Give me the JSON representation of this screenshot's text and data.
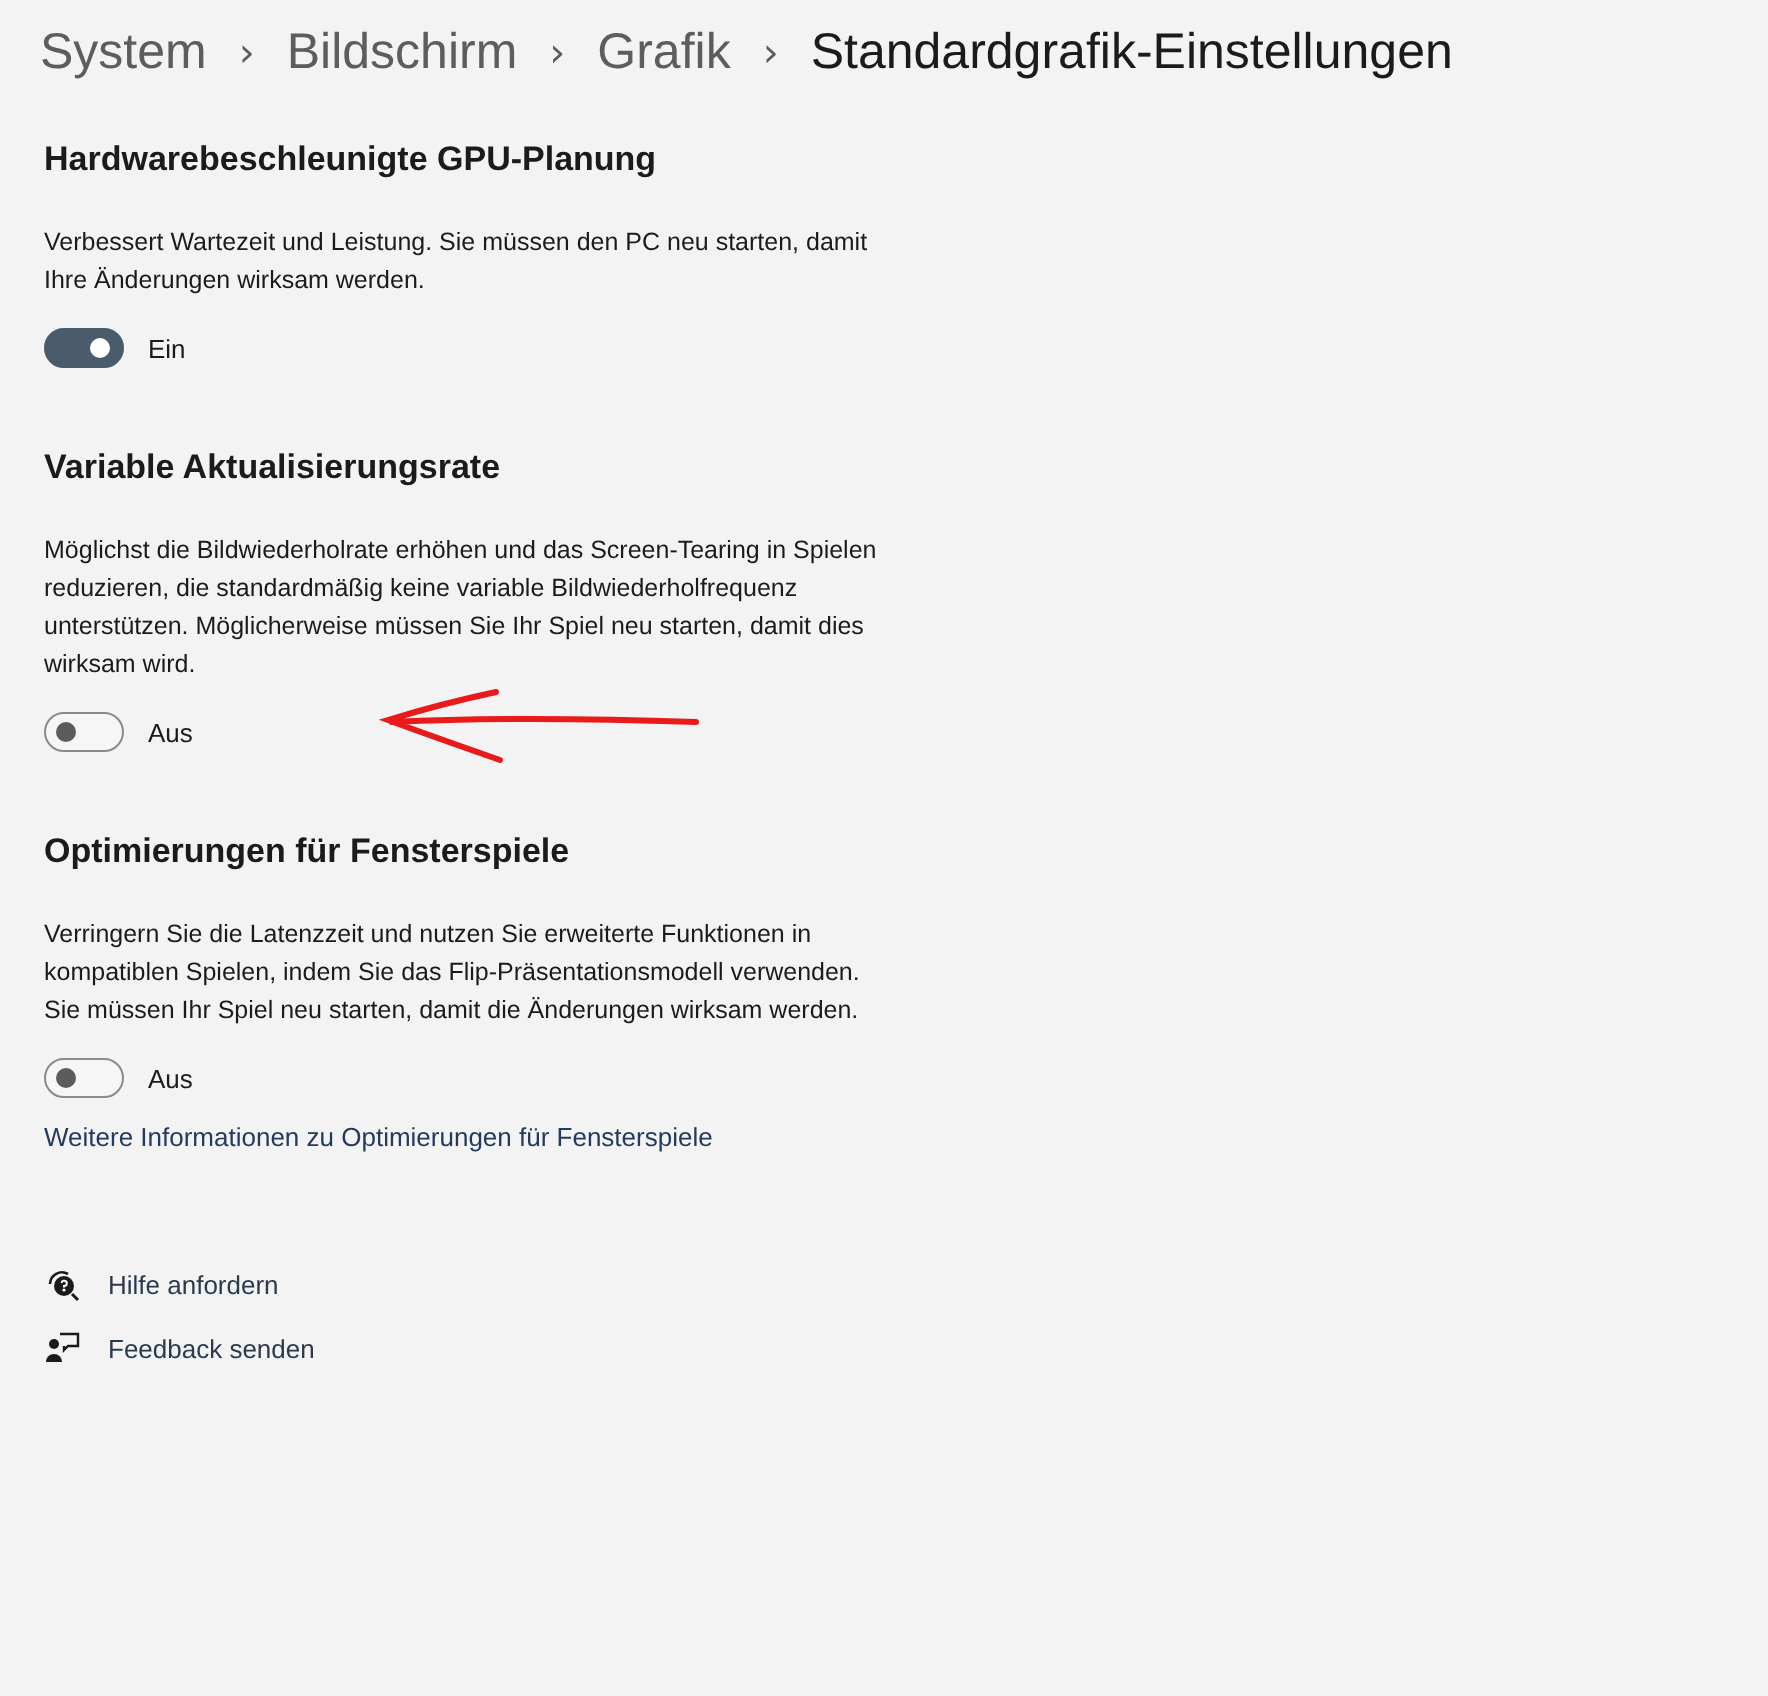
{
  "breadcrumb": [
    {
      "label": "System",
      "current": false
    },
    {
      "label": "Bildschirm",
      "current": false
    },
    {
      "label": "Grafik",
      "current": false
    },
    {
      "label": "Standardgrafik-Einstellungen",
      "current": true
    }
  ],
  "breadcrumb_separator": "›",
  "sections": [
    {
      "title": "Hardwarebeschleunigte GPU-Planung",
      "description": "Verbessert Wartezeit und Leistung. Sie müssen den PC neu starten, damit Ihre Änderungen wirksam werden.",
      "toggle": {
        "on": true,
        "label": "Ein"
      },
      "annotated": false
    },
    {
      "title": "Variable Aktualisierungsrate",
      "description": "Möglichst die Bildwiederholrate erhöhen und das Screen-Tearing in Spielen reduzieren, die standardmäßig keine variable Bildwiederholfrequenz unterstützen. Möglicherweise müssen Sie Ihr Spiel neu starten, damit dies wirksam wird.",
      "toggle": {
        "on": false,
        "label": "Aus"
      },
      "annotated": true
    },
    {
      "title": "Optimierungen für Fensterspiele",
      "description": "Verringern Sie die Latenzzeit und nutzen Sie erweiterte Funktionen in kompatiblen Spielen, indem Sie das Flip-Präsentationsmodell verwenden. Sie müssen Ihr Spiel neu starten, damit die Änderungen wirksam werden.",
      "toggle": {
        "on": false,
        "label": "Aus"
      },
      "link": "Weitere Informationen zu Optimierungen für Fensterspiele",
      "annotated": false
    }
  ],
  "help_links": [
    {
      "kind": "help",
      "label": "Hilfe anfordern"
    },
    {
      "kind": "feedback",
      "label": "Feedback senden"
    }
  ]
}
